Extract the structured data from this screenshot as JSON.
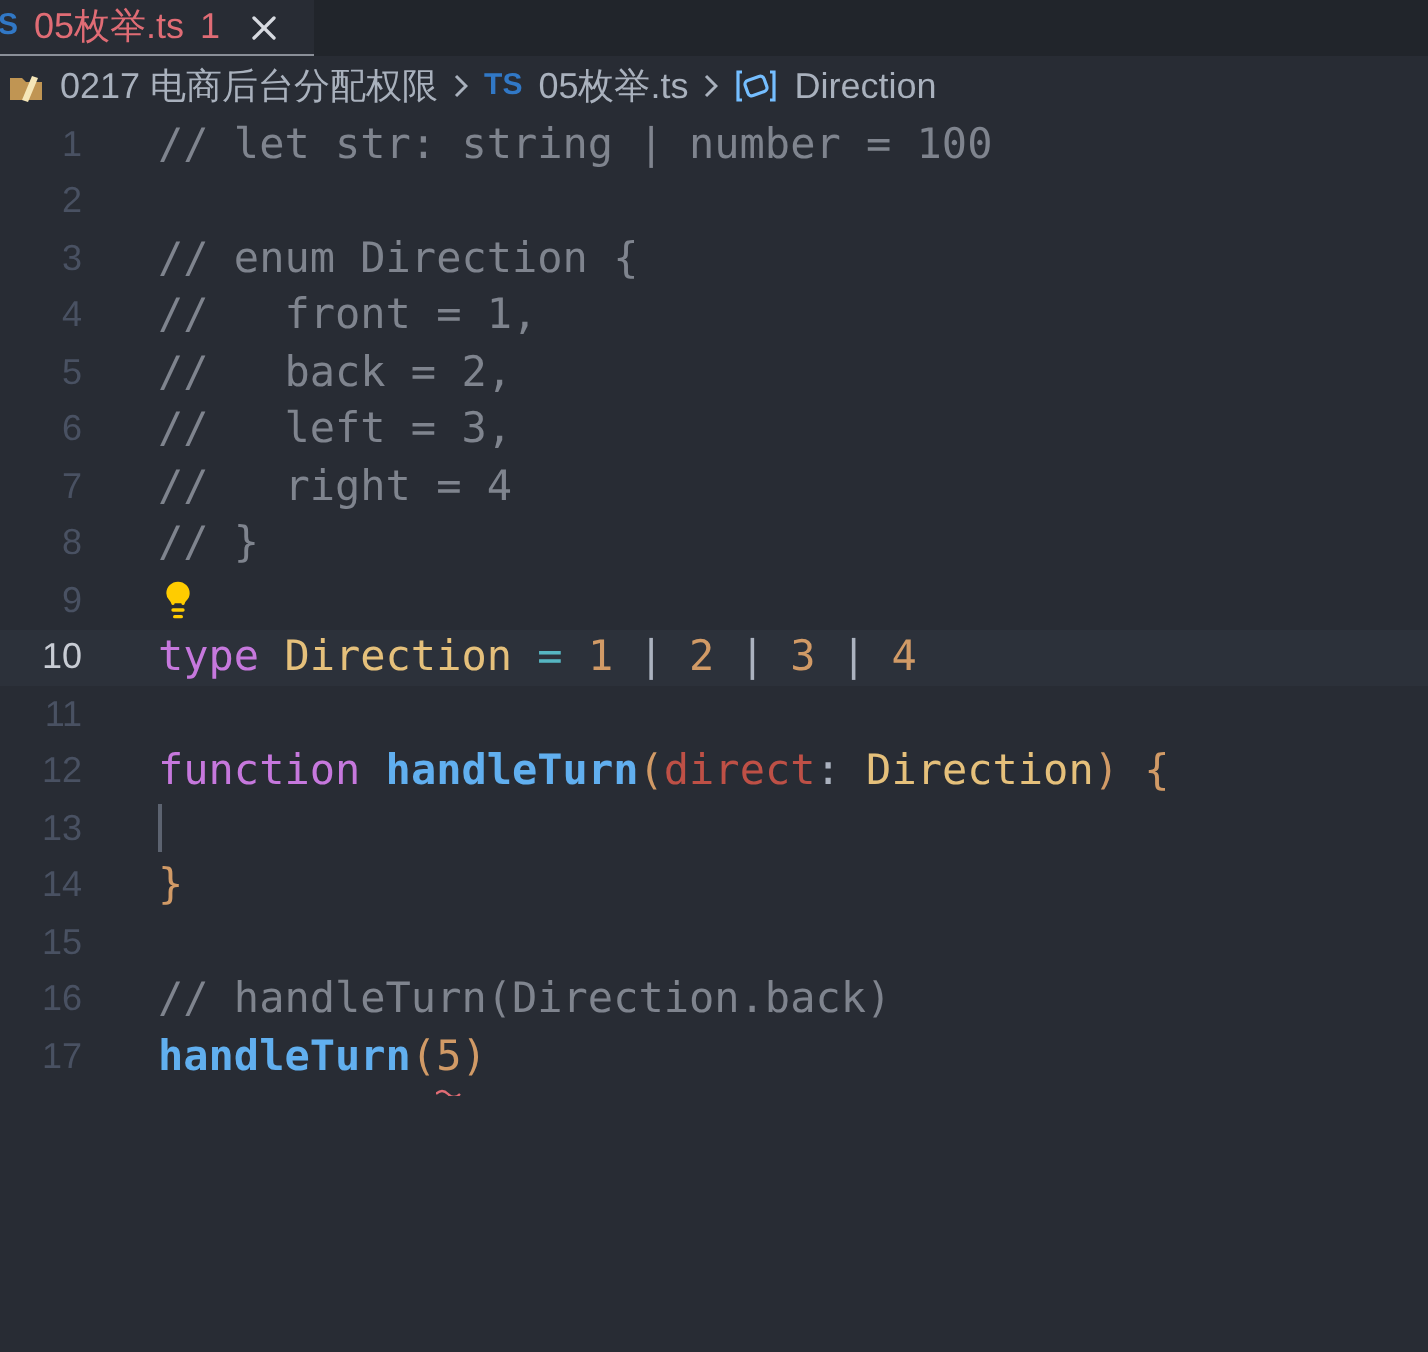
{
  "tab": {
    "icon": "S",
    "label": "05枚举.ts",
    "problems": "1",
    "selected": true
  },
  "breadcrumb": [
    {
      "kind": "folder",
      "label": "0217 电商后台分配权限"
    },
    {
      "kind": "ts",
      "icon": "TS",
      "label": "05枚举.ts"
    },
    {
      "kind": "symbol",
      "label": "Direction"
    }
  ],
  "lines": [
    {
      "number": "1",
      "tokens": [
        {
          "kind": "comment",
          "text": "// let str: string | number = 100"
        }
      ]
    },
    {
      "number": "2"
    },
    {
      "number": "3",
      "tokens": [
        {
          "kind": "comment",
          "text": "// enum Direction {"
        }
      ]
    },
    {
      "number": "4",
      "tokens": [
        {
          "kind": "comment",
          "text": "//   front = 1,"
        }
      ]
    },
    {
      "number": "5",
      "tokens": [
        {
          "kind": "comment",
          "text": "//   back = 2,"
        }
      ]
    },
    {
      "number": "6",
      "tokens": [
        {
          "kind": "comment",
          "text": "//   left = 3,"
        }
      ]
    },
    {
      "number": "7",
      "tokens": [
        {
          "kind": "comment",
          "text": "//   right = 4"
        }
      ]
    },
    {
      "number": "8",
      "tokens": [
        {
          "kind": "comment",
          "text": "// }"
        }
      ]
    },
    {
      "number": "9",
      "lightbulb": true
    },
    {
      "number": "10",
      "selected": true,
      "tokens": [
        {
          "kind": "keyword",
          "text": "type"
        },
        {
          "kind": "type",
          "text": " Direction"
        },
        {
          "kind": "operator",
          "text": " ="
        },
        {
          "kind": "number",
          "text": " 1"
        },
        {
          "kind": "plain",
          "text": " | "
        },
        {
          "kind": "number",
          "text": "2"
        },
        {
          "kind": "plain",
          "text": " | "
        },
        {
          "kind": "number",
          "text": "3"
        },
        {
          "kind": "plain",
          "text": " | "
        },
        {
          "kind": "number",
          "text": "4"
        }
      ]
    },
    {
      "number": "11"
    },
    {
      "number": "12",
      "tokens": [
        {
          "kind": "keyword",
          "text": "function"
        },
        {
          "kind": "function",
          "text": " handleTurn"
        },
        {
          "kind": "punct",
          "text": "("
        },
        {
          "kind": "param",
          "text": "direct"
        },
        {
          "kind": "plain",
          "text": ": "
        },
        {
          "kind": "type",
          "text": "Direction"
        },
        {
          "kind": "punct",
          "text": ")"
        },
        {
          "kind": "punct",
          "text": " {"
        }
      ]
    },
    {
      "number": "13",
      "cursor": true
    },
    {
      "number": "14",
      "tokens": [
        {
          "kind": "punct",
          "text": "}"
        }
      ]
    },
    {
      "number": "15"
    },
    {
      "number": "16",
      "tokens": [
        {
          "kind": "comment",
          "text": "// handleTurn(Direction.back)"
        }
      ]
    },
    {
      "number": "17",
      "tokens": [
        {
          "kind": "function",
          "text": "handleTurn"
        },
        {
          "kind": "punct",
          "text": "("
        },
        {
          "kind": "number",
          "text": "5",
          "error": true
        },
        {
          "kind": "punct",
          "text": ")"
        }
      ]
    }
  ]
}
